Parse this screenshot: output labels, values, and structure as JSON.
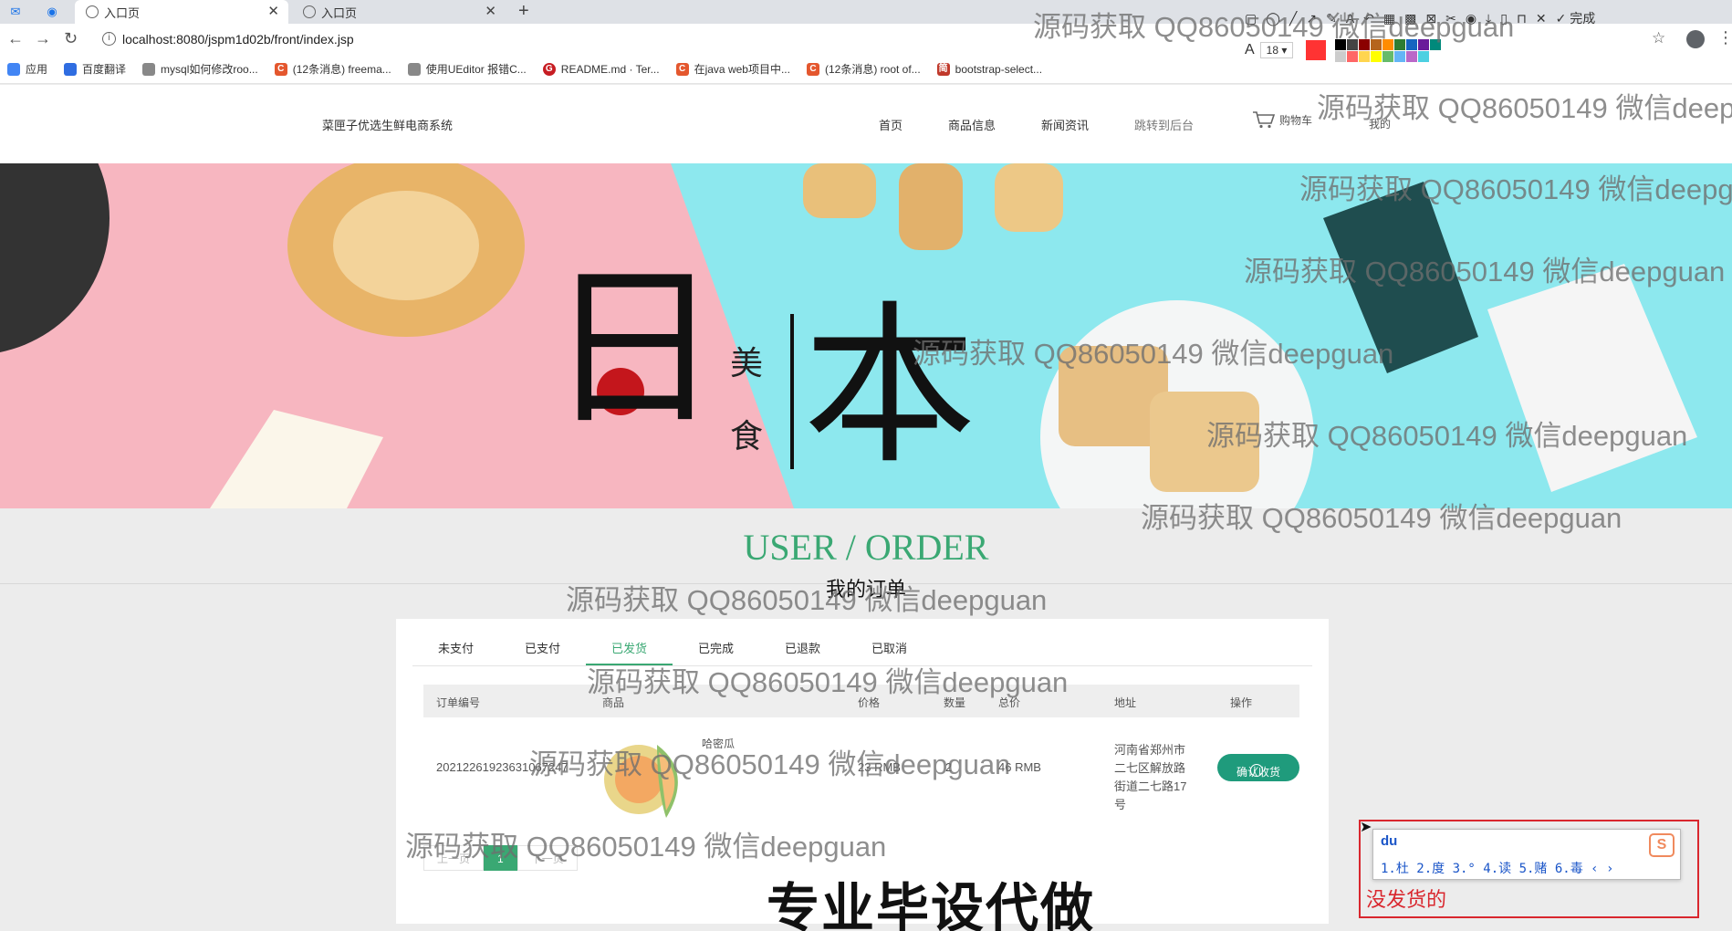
{
  "browser": {
    "tabs": [
      {
        "label": "入口页",
        "active": true
      },
      {
        "label": "入口页",
        "active": false
      }
    ],
    "url": "localhost:8080/jspm1d02b/front/index.jsp",
    "bookmarks": [
      {
        "label": "应用",
        "color": "#4285f4"
      },
      {
        "label": "百度翻译",
        "color": "#2f6de1"
      },
      {
        "label": "mysql如何修改roo...",
        "color": "#666666"
      },
      {
        "label": "(12条消息) freema...",
        "color": "#e4572e"
      },
      {
        "label": "使用UEditor 报错C...",
        "color": "#666666"
      },
      {
        "label": "README.md · Ter...",
        "color": "#c71d23"
      },
      {
        "label": "在java web项目中...",
        "color": "#e4572e"
      },
      {
        "label": "(12条消息) root of...",
        "color": "#e4572e"
      },
      {
        "label": "bootstrap-select...",
        "color": "#c0392b"
      }
    ]
  },
  "snap_tool": {
    "done_label": "完成",
    "font_size": "18",
    "colors": [
      "#ff3333",
      "#000000",
      "#444444",
      "#8b0000",
      "#b5651d",
      "#ff8c00",
      "#2e7d32",
      "#1565c0",
      "#6a1b9a",
      "#00897b",
      "#ffffff",
      "#cccccc",
      "#ff6666",
      "#ffd54f",
      "#ffff00",
      "#66bb6a",
      "#64b5f6",
      "#ba68c8",
      "#4dd0e1"
    ]
  },
  "site": {
    "title": "菜匣子优选生鲜电商系统",
    "nav": [
      "首页",
      "商品信息",
      "新闻资讯",
      "跳转到后台"
    ],
    "cart_label": "购物车",
    "mine_label": "我的"
  },
  "banner": {
    "big_chars": [
      "日",
      "本"
    ],
    "small_chars": [
      "美",
      "食"
    ]
  },
  "order_section": {
    "title": "USER / ORDER",
    "subtitle": "我的订单",
    "tabs": [
      {
        "label": "未支付",
        "active": false
      },
      {
        "label": "已支付",
        "active": false
      },
      {
        "label": "已发货",
        "active": true
      },
      {
        "label": "已完成",
        "active": false
      },
      {
        "label": "已退款",
        "active": false
      },
      {
        "label": "已取消",
        "active": false
      }
    ],
    "columns": [
      "订单编号",
      "商品",
      "价格",
      "数量",
      "总价",
      "地址",
      "操作"
    ],
    "rows": [
      {
        "order_no": "20212261923631067247",
        "product": "哈密瓜",
        "price": "23 RMB",
        "qty": "2",
        "total": "46 RMB",
        "address": "河南省郑州市二七区解放路街道二七路17号",
        "action": "确认收货"
      }
    ],
    "pager": {
      "prev": "上一页",
      "current": "1",
      "next": "下一页"
    }
  },
  "promo_text": "专业毕设代做",
  "ime": {
    "input": "du",
    "candidates": "1.杜  2.度  3.°  4.读  5.赌  6.毒  ‹ ›",
    "logo": "S"
  },
  "annotation": {
    "text": "没发货的"
  },
  "watermark": "源码获取 QQ86050149 微信deepguan"
}
